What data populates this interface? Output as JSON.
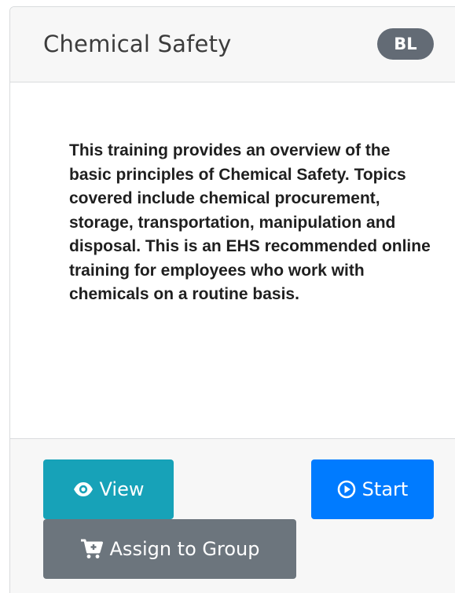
{
  "card": {
    "title": "Chemical Safety",
    "badge": "BL",
    "description": "This training provides an overview of the basic principles of Chemical Safety. Topics covered include chemical procurement, storage, transportation, manipulation and disposal. This is an EHS recommended online training for employees who work with chemicals on a routine basis."
  },
  "actions": {
    "view_label": "View",
    "start_label": "Start",
    "assign_label": "Assign to Group"
  },
  "icons": {
    "view": "eye-icon",
    "start": "play-circle-icon",
    "assign": "cart-plus-icon"
  },
  "colors": {
    "view_button": "#17a2b8",
    "start_button": "#007bff",
    "assign_button": "#6c757d",
    "badge": "#636b75",
    "header_background": "#f7f7f7"
  }
}
